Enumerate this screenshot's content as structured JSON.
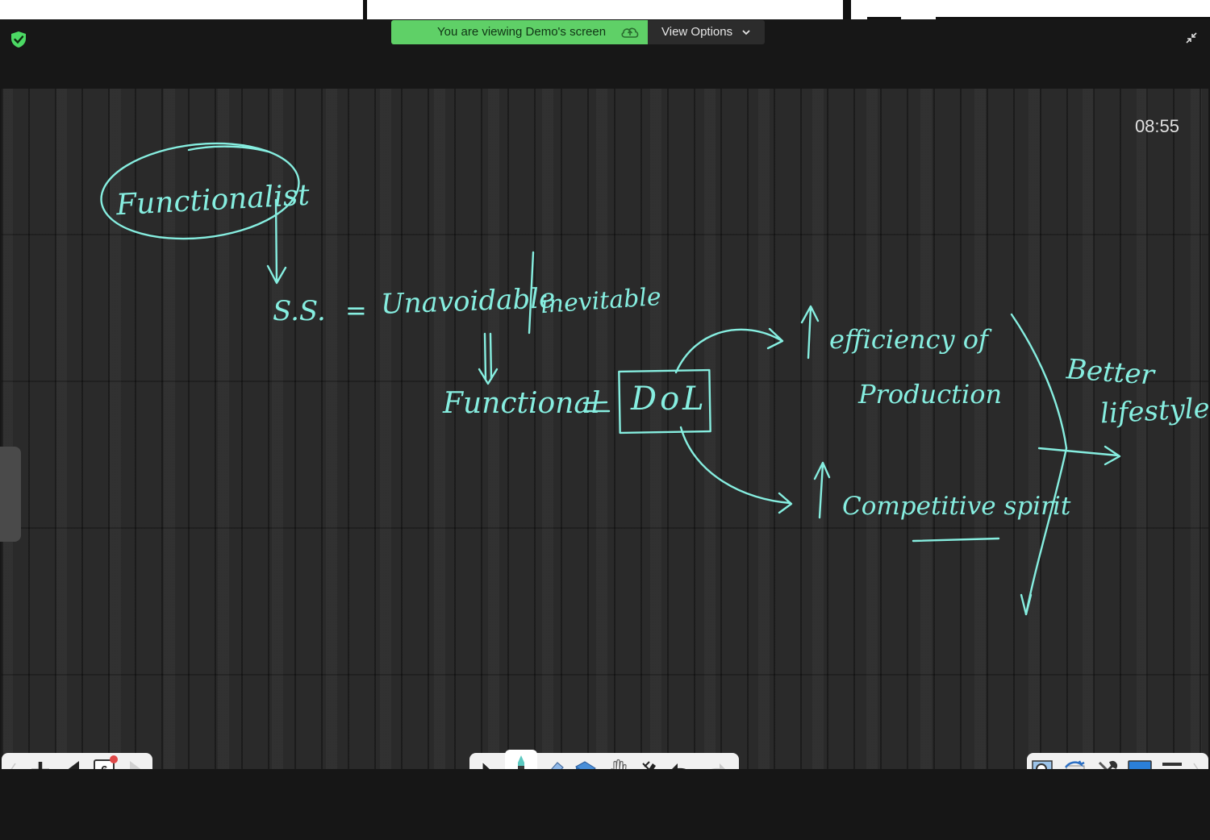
{
  "banner": {
    "viewing_text": "You are viewing Demo's screen",
    "view_options_label": "View Options"
  },
  "whiteboard": {
    "timer": "08:55",
    "handwriting": {
      "functionalist": "Functionalist",
      "ss": "S.S.",
      "equals1": "=",
      "unavoidable": "Unavoidable",
      "inevitable": "inevitable",
      "functional": "Functional",
      "equals2": "=",
      "dol": "DoL",
      "efficiency": "efficiency of",
      "production": "Production",
      "competitive": "Competitive spirit",
      "better": "Better",
      "lifestyle": "lifestyle"
    },
    "ink_color": "#86eee0"
  },
  "toolbar_left": {
    "page_number": "6"
  },
  "colors": {
    "banner_green": "#5fd067",
    "shield_green": "#4cd964",
    "page_badge_red": "#e04848"
  }
}
